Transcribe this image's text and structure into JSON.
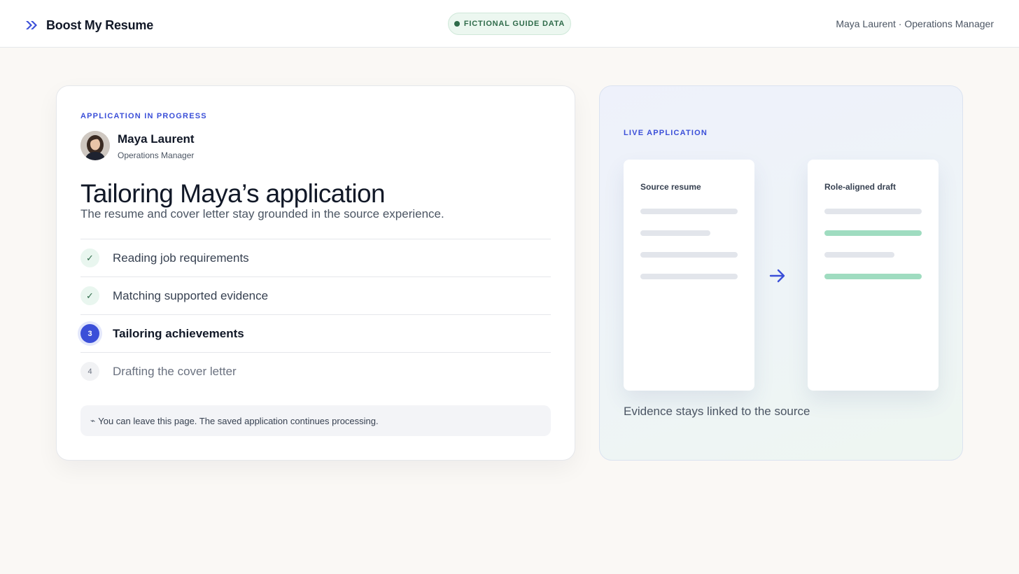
{
  "header": {
    "brand_name": "Boost My Resume",
    "brand_icon": "double-chevron-right-icon",
    "badge_label": "FICTIONAL GUIDE DATA",
    "user_meta": "Maya Laurent · Operations Manager"
  },
  "progress_card": {
    "eyebrow": "APPLICATION IN PROGRESS",
    "person": {
      "name": "Maya Laurent",
      "role": "Operations Manager"
    },
    "title": "Tailoring Maya’s application",
    "subtitle": "The resume and cover letter stay grounded in the source experience.",
    "steps": [
      {
        "marker": "✓",
        "label": "Reading job requirements",
        "status": "done"
      },
      {
        "marker": "✓",
        "label": "Matching supported evidence",
        "status": "done"
      },
      {
        "marker": "3",
        "label": "Tailoring achievements",
        "status": "active"
      },
      {
        "marker": "4",
        "label": "Drafting the cover letter",
        "status": "pending"
      }
    ],
    "notice": "You can leave this page. The saved application continues processing."
  },
  "live_card": {
    "eyebrow": "LIVE APPLICATION",
    "source_doc_title": "Source resume",
    "draft_doc_title": "Role-aligned draft",
    "caption": "Evidence stays linked to the source"
  },
  "colors": {
    "accent": "#3b4fd8",
    "success": "#2f6b4a",
    "highlight_line": "#9fdcc0",
    "page_bg": "#faf8f5"
  }
}
